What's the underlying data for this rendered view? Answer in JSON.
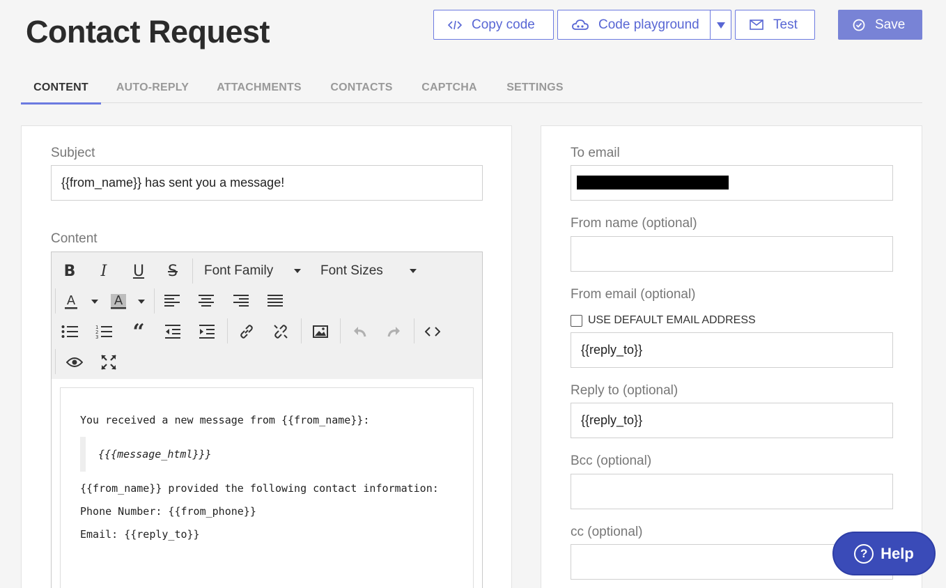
{
  "header": {
    "title": "Contact Request",
    "copy_code_label": "Copy code",
    "code_playground_label": "Code playground",
    "test_label": "Test",
    "save_label": "Save"
  },
  "tabs": [
    {
      "label": "CONTENT",
      "active": true
    },
    {
      "label": "AUTO-REPLY",
      "active": false
    },
    {
      "label": "ATTACHMENTS",
      "active": false
    },
    {
      "label": "CONTACTS",
      "active": false
    },
    {
      "label": "CAPTCHA",
      "active": false
    },
    {
      "label": "SETTINGS",
      "active": false
    }
  ],
  "left": {
    "subject_label": "Subject",
    "subject_value": "{{from_name}} has sent you a message!",
    "content_label": "Content",
    "toolbar": {
      "font_family": "Font Family",
      "font_sizes": "Font Sizes"
    },
    "editor": {
      "line1": "You received a new message from {{from_name}}:",
      "quote": "{{{message_html}}}",
      "line2": "{{from_name}} provided the following contact information:",
      "line3": "Phone Number: {{from_phone}}",
      "line4": "Email: {{reply_to}}"
    }
  },
  "right": {
    "to_email_label": "To email",
    "from_name_label": "From name (optional)",
    "from_email_label": "From email (optional)",
    "use_default_label": "USE DEFAULT EMAIL ADDRESS",
    "from_email_value": "{{reply_to}}",
    "reply_to_label": "Reply to (optional)",
    "reply_to_value": "{{reply_to}}",
    "bcc_label": "Bcc (optional)",
    "cc_label": "cc (optional)"
  },
  "help": {
    "label": "Help"
  },
  "colors": {
    "accent": "#6c7ae0",
    "save_bg": "#7883d6",
    "help_bg": "#3a4bb8"
  }
}
